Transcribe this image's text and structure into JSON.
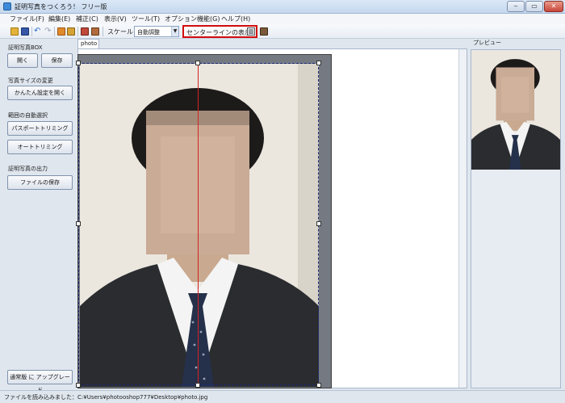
{
  "window": {
    "title": "証明写真をつくろう！ フリー版"
  },
  "menu": [
    {
      "label": "ファイル(F)"
    },
    {
      "label": "編集(E)"
    },
    {
      "label": "補正(C)"
    },
    {
      "label": "表示(V)"
    },
    {
      "label": "ツール(T)"
    },
    {
      "label": "オプション機能(G)"
    },
    {
      "label": "ヘルプ(H)"
    }
  ],
  "toolbar": {
    "scale_label": "スケール",
    "scale_value": "自動調整",
    "centerline_label": "センターラインの表示"
  },
  "left_panel": {
    "box_section": "証明写真BOX",
    "open_button": "開く",
    "save_button": "保存",
    "size_section": "写真サイズの変更",
    "easy_settings_button": "かんたん設定を開く",
    "auto_select_section": "範囲の自動選択",
    "passport_trim_button": "パスポートトリミング",
    "auto_trim_button": "オートトリミング",
    "output_section": "証明写真の出力",
    "save_file_button": "ファイルの保存",
    "upgrade_button": "通常版 に アップグレード"
  },
  "document": {
    "tab_label": "photo"
  },
  "preview": {
    "label": "プレビュー"
  },
  "status": {
    "text": "ファイルを読み込みました：C:¥Users¥photooshop777¥Desktop¥photo.jpg"
  },
  "colors": {
    "highlight_border": "#d10d0d",
    "center_line": "#d32323",
    "crop_border": "#1f2c79"
  }
}
